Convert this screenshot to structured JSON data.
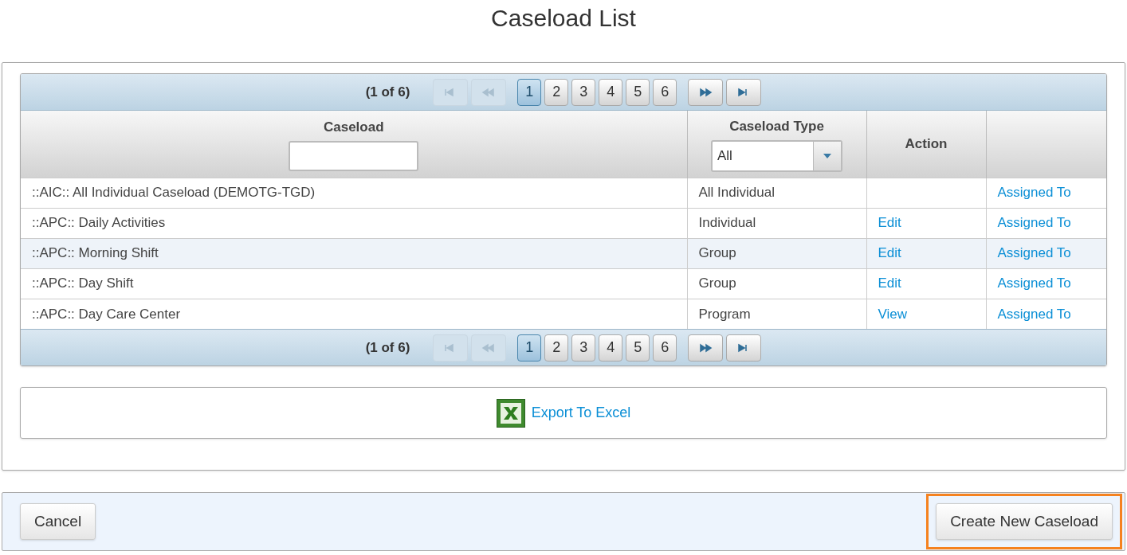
{
  "title": "Caseload List",
  "pager_top": {
    "summary": "(1 of 6)",
    "first_disabled": true,
    "prev_disabled": true,
    "next_disabled": false,
    "last_disabled": false,
    "pages": [
      {
        "label": "1",
        "selected": true
      },
      {
        "label": "2",
        "selected": false
      },
      {
        "label": "3",
        "selected": false
      },
      {
        "label": "4",
        "selected": false
      },
      {
        "label": "5",
        "selected": false
      },
      {
        "label": "6",
        "selected": false
      }
    ]
  },
  "table": {
    "columns": [
      {
        "label": "Caseload",
        "kind": "text"
      },
      {
        "label": "Caseload Type",
        "kind": "select",
        "value": "All"
      },
      {
        "label": "Action",
        "kind": "plain"
      }
    ],
    "rows": [
      {
        "caseload": "::AIC:: All Individual Caseload (DEMOTG-TGD)",
        "type": "All Individual",
        "link": "Assigned To",
        "highlighted": false
      },
      {
        "caseload": "::APC:: Daily Activities",
        "type": "Individual",
        "action": "Edit",
        "link": "Assigned To",
        "highlighted": false
      },
      {
        "caseload": "::APC:: Morning Shift",
        "type": "Group",
        "action": "Edit",
        "link": "Assigned To",
        "highlighted": true
      },
      {
        "caseload": "::APC:: Day Shift",
        "type": "Group",
        "action": "Edit",
        "link": "Assigned To",
        "highlighted": false
      },
      {
        "caseload": "::APC:: Day Care Center",
        "type": "Program",
        "action": "View",
        "link": "Assigned To",
        "highlighted": false
      }
    ]
  },
  "pager_bottom": {
    "summary": "(1 of 6)",
    "first_disabled": true,
    "prev_disabled": true,
    "next_disabled": false,
    "last_disabled": false,
    "pages": [
      {
        "label": "1",
        "selected": true
      },
      {
        "label": "2",
        "selected": false
      },
      {
        "label": "3",
        "selected": false
      },
      {
        "label": "4",
        "selected": false
      },
      {
        "label": "5",
        "selected": false
      },
      {
        "label": "6",
        "selected": false
      }
    ]
  },
  "export": {
    "label": "Export To Excel"
  },
  "footer": {
    "cancel": "Cancel",
    "create": "Create New Caseload",
    "create_focused": true
  }
}
